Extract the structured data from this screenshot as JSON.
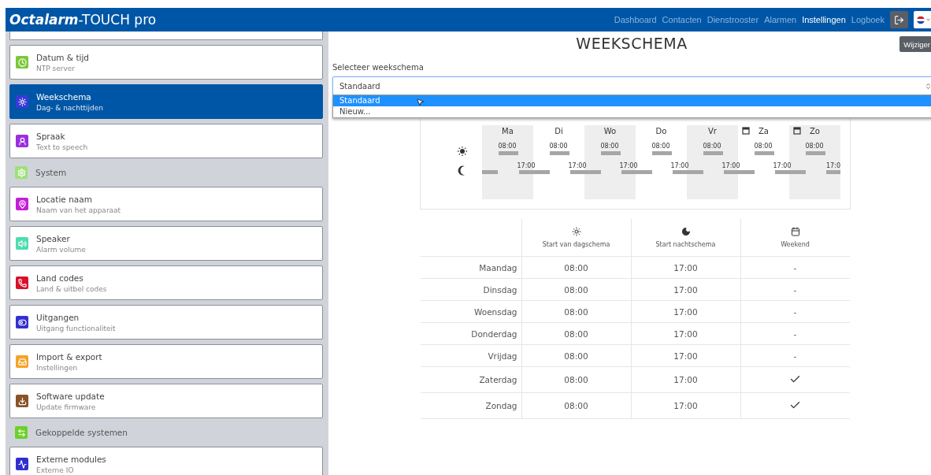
{
  "header": {
    "brand_bold": "Octalarm",
    "brand_rest": "-TOUCH pro",
    "nav": [
      {
        "label": "Dashboard",
        "selected": false
      },
      {
        "label": "Contacten",
        "selected": false
      },
      {
        "label": "Dienstrooster",
        "selected": false
      },
      {
        "label": "Alarmen",
        "selected": false
      },
      {
        "label": "Instellingen",
        "selected": true
      },
      {
        "label": "Logboek",
        "selected": false
      }
    ]
  },
  "sidebar": {
    "items": [
      {
        "kind": "cut"
      },
      {
        "kind": "item",
        "title": "Datum & tijd",
        "subtitle": "NTP server",
        "color": "#7cc83a",
        "selected": false
      },
      {
        "kind": "item",
        "title": "Weekschema",
        "subtitle": "Dag- & nachttijden",
        "color": "#3a3ad8",
        "selected": true
      },
      {
        "kind": "item",
        "title": "Spraak",
        "subtitle": "Text to speech",
        "color": "#9b2fe0",
        "selected": false
      },
      {
        "kind": "group",
        "title": "System",
        "color": "#9fe07a"
      },
      {
        "kind": "item",
        "title": "Locatie naam",
        "subtitle": "Naam van het apparaat",
        "color": "#c41fd6",
        "selected": false
      },
      {
        "kind": "item",
        "title": "Speaker",
        "subtitle": "Alarm volume",
        "color": "#4fdcb0",
        "selected": false
      },
      {
        "kind": "item",
        "title": "Land codes",
        "subtitle": "Land & uitbel codes",
        "color": "#d8102a",
        "selected": false
      },
      {
        "kind": "item",
        "title": "Uitgangen",
        "subtitle": "Uitgang functionaliteit",
        "color": "#3430d0",
        "selected": false
      },
      {
        "kind": "item",
        "title": "Import & export",
        "subtitle": "Instellingen",
        "color": "#f4a428",
        "selected": false
      },
      {
        "kind": "item",
        "title": "Software update",
        "subtitle": "Update firmware",
        "color": "#8a5228",
        "selected": false
      },
      {
        "kind": "group",
        "title": "Gekoppelde systemen",
        "color": "#6cd02a"
      },
      {
        "kind": "item",
        "title": "Externe modules",
        "subtitle": "Externe IO",
        "color": "#3030d0",
        "selected": false
      }
    ]
  },
  "main": {
    "title": "WEEKSCHEMA",
    "edit_button": "Wijziger",
    "select": {
      "label": "Selecteer weekschema",
      "value": "Standaard",
      "options": [
        {
          "label": "Standaard",
          "selected": true
        },
        {
          "label": "Nieuw...",
          "selected": false
        }
      ]
    },
    "timeline": [
      {
        "day": "Ma",
        "weekend": false,
        "day_start": "08:00",
        "night_start": "17:00"
      },
      {
        "day": "Di",
        "weekend": false,
        "day_start": "08:00",
        "night_start": "17:00"
      },
      {
        "day": "Wo",
        "weekend": false,
        "day_start": "08:00",
        "night_start": "17:00"
      },
      {
        "day": "Do",
        "weekend": false,
        "day_start": "08:00",
        "night_start": "17:00"
      },
      {
        "day": "Vr",
        "weekend": false,
        "day_start": "08:00",
        "night_start": "17:00"
      },
      {
        "day": "Za",
        "weekend": true,
        "day_start": "08:00",
        "night_start": "17:00"
      },
      {
        "day": "Zo",
        "weekend": true,
        "day_start": "08:00",
        "night_start": "17:0"
      }
    ],
    "table": {
      "columns": [
        "Start van dagschema",
        "Start nachtschema",
        "Weekend"
      ],
      "rows": [
        {
          "day": "Maandag",
          "day_start": "08:00",
          "night_start": "17:00",
          "weekend": false,
          "weekend_text": "-"
        },
        {
          "day": "Dinsdag",
          "day_start": "08:00",
          "night_start": "17:00",
          "weekend": false,
          "weekend_text": "-"
        },
        {
          "day": "Woensdag",
          "day_start": "08:00",
          "night_start": "17:00",
          "weekend": false,
          "weekend_text": "-"
        },
        {
          "day": "Donderdag",
          "day_start": "08:00",
          "night_start": "17:00",
          "weekend": false,
          "weekend_text": "-"
        },
        {
          "day": "Vrijdag",
          "day_start": "08:00",
          "night_start": "17:00",
          "weekend": false,
          "weekend_text": "-"
        },
        {
          "day": "Zaterdag",
          "day_start": "08:00",
          "night_start": "17:00",
          "weekend": true
        },
        {
          "day": "Zondag",
          "day_start": "08:00",
          "night_start": "17:00",
          "weekend": true
        }
      ]
    }
  }
}
